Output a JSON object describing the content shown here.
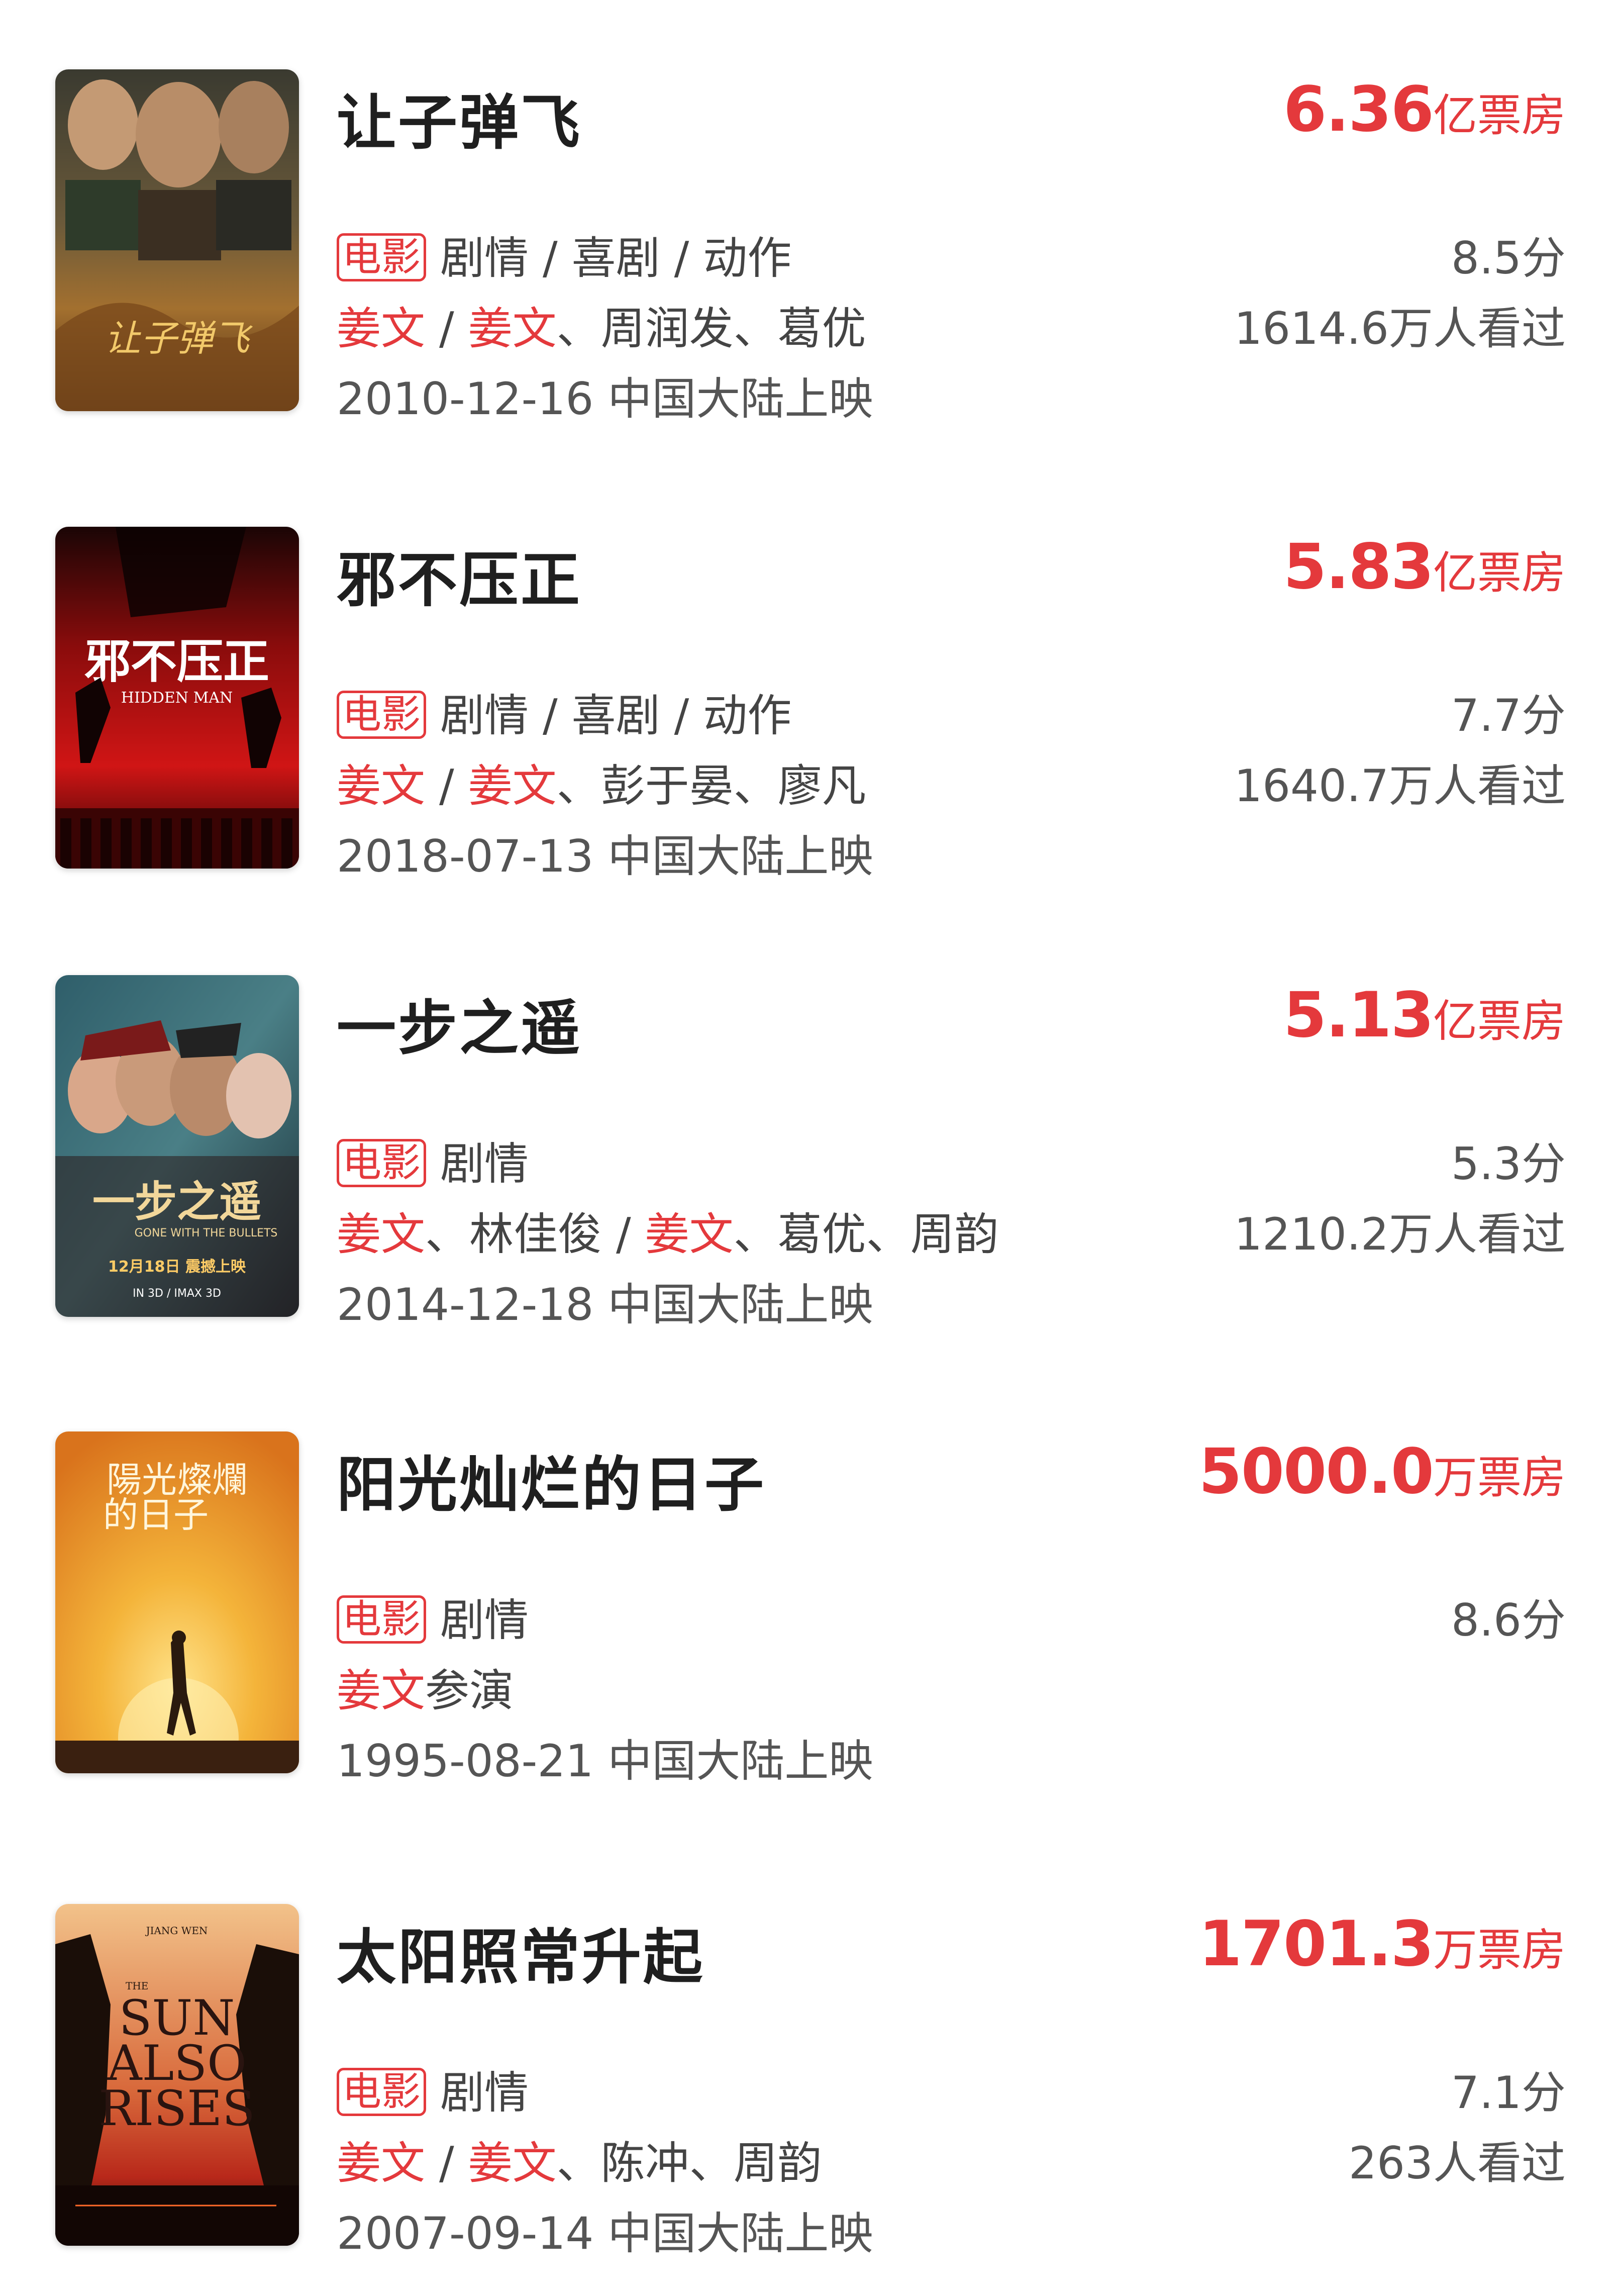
{
  "colors": {
    "accent": "#e4393c",
    "title": "#1f1f1f",
    "meta": "#555555"
  },
  "movies": [
    {
      "title": "让子弹飞",
      "box_value": "6.36",
      "box_unit": "亿票房",
      "tag": "电影",
      "genres": "剧情 / 喜剧 / 动作",
      "director": "姜文",
      "sep": " / ",
      "actor_lead": "姜文",
      "actors_rest": "、周润发、葛优",
      "score": "8.5分",
      "viewers": "1614.6万人看过",
      "release": "2010-12-16 中国大陆上映",
      "poster_text": "让子弹飞"
    },
    {
      "title": "邪不压正",
      "box_value": "5.83",
      "box_unit": "亿票房",
      "tag": "电影",
      "genres": "剧情 / 喜剧 / 动作",
      "director": "姜文",
      "sep": " / ",
      "actor_lead": "姜文",
      "actors_rest": "、彭于晏、廖凡",
      "score": "7.7分",
      "viewers": "1640.7万人看过",
      "release": "2018-07-13 中国大陆上映",
      "poster_text": "邪不压正",
      "poster_subtext": "HIDDEN MAN"
    },
    {
      "title": "一步之遥",
      "box_value": "5.13",
      "box_unit": "亿票房",
      "tag": "电影",
      "genres": "剧情",
      "director": "姜文",
      "director_rest": "、林佳俊",
      "sep": " / ",
      "actor_lead": "姜文",
      "actors_rest": "、葛优、周韵",
      "score": "5.3分",
      "viewers": "1210.2万人看过",
      "release": "2014-12-18 中国大陆上映",
      "poster_text": "一步之遥",
      "poster_subtext": "GONE WITH THE BULLETS",
      "poster_date": "12月18日 震撼上映",
      "poster_format": "IN 3D / IMAX 3D"
    },
    {
      "title": "阳光灿烂的日子",
      "box_value": "5000.0",
      "box_unit": "万票房",
      "tag": "电影",
      "genres": "剧情",
      "actor_lead": "姜文",
      "actors_rest": "参演",
      "score": "8.6分",
      "release": "1995-08-21 中国大陆上映",
      "poster_text_line1": "陽光燦爛",
      "poster_text_line2": "的日子"
    },
    {
      "title": "太阳照常升起",
      "box_value": "1701.3",
      "box_unit": "万票房",
      "tag": "电影",
      "genres": "剧情",
      "director": "姜文",
      "sep": " / ",
      "actor_lead": "姜文",
      "actors_rest": "、陈冲、周韵",
      "score": "7.1分",
      "viewers": "263人看过",
      "release": "2007-09-14 中国大陆上映",
      "poster_top": "JIANG WEN",
      "poster_small": "THE",
      "poster_line1": "SUN",
      "poster_line2": "ALSO",
      "poster_line3": "RISES"
    }
  ]
}
